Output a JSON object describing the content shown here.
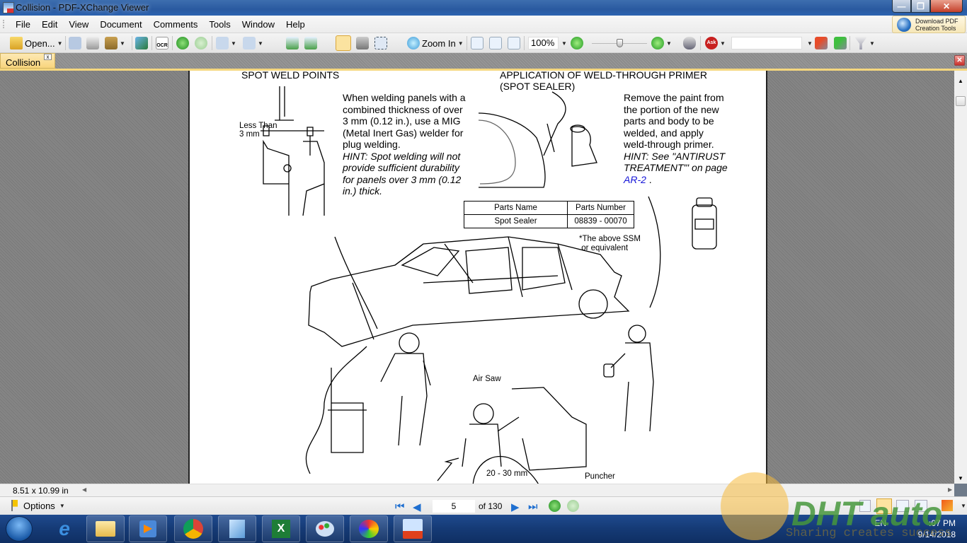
{
  "window": {
    "title": "Collision - PDF-XChange Viewer",
    "minimize_glyph": "—",
    "restore_glyph": "❐",
    "close_glyph": "✕"
  },
  "menu": {
    "items": [
      "File",
      "Edit",
      "View",
      "Document",
      "Comments",
      "Tools",
      "Window",
      "Help"
    ]
  },
  "promo": {
    "line1": "Download PDF",
    "line2": "Creation Tools"
  },
  "toolbar": {
    "open_label": "Open...",
    "zoom_in_label": "Zoom In",
    "zoom_value": "100%",
    "search_value": "",
    "ocr_label": "OCR",
    "ask_label": "Ask",
    "zoom_slider_fraction": 0.5,
    "icons": [
      "open-folder-icon",
      "save-icon",
      "print-icon",
      "email-icon",
      "scan-icon",
      "ocr-icon",
      "back-icon",
      "forward-icon",
      "undo-icon",
      "redo-icon",
      "rotate-left-icon",
      "rotate-right-icon",
      "hand-tool-icon",
      "snapshot-icon",
      "select-text-icon",
      "zoom-in-icon",
      "actual-size-icon",
      "fit-page-icon",
      "fit-width-icon",
      "zoom-out-icon",
      "zoom-plus-icon",
      "find-icon",
      "ask-icon",
      "find-previous-icon",
      "find-next-icon",
      "filter-icon"
    ]
  },
  "tab": {
    "label": "Collision",
    "close_glyph": "x"
  },
  "document": {
    "left_heading": "SPOT WELD POINTS",
    "right_heading_line1": "APPLICATION OF WELD-THROUGH PRIMER",
    "right_heading_line2": "(SPOT SEALER)",
    "caliper_label_1": "Less Than",
    "caliper_label_2": "3 mm",
    "left_para": [
      "When welding panels with a",
      "combined thickness of over",
      "3 mm (0.12 in.), use a MIG",
      "(Metal Inert Gas) welder for",
      "plug welding."
    ],
    "left_hint": [
      "HINT: Spot welding will not",
      "provide sufficient durability",
      "for panels over 3 mm (0.12",
      "in.) thick."
    ],
    "right_para": [
      "Remove the paint from",
      "the portion of the new",
      "parts and body to be",
      "welded, and apply",
      "weld-through  primer."
    ],
    "right_hint": [
      "HINT: See \"ANTIRUST",
      "TREATMENT\"' on page"
    ],
    "right_link": "AR-2",
    "right_link_suffix": " .",
    "parts_table": {
      "headers": [
        "Parts Name",
        "Parts Number"
      ],
      "rows": [
        [
          "Spot Sealer",
          "08839 - 00070"
        ]
      ]
    },
    "ssm_note_1": "*The above SSM",
    "ssm_note_2": " or equivalent",
    "air_saw_label": "Air Saw",
    "range_label": "20 - 30 mm",
    "puncher_label": "Puncher"
  },
  "status": {
    "page_size": "8.51 x 10.99 in",
    "options_label": "Options",
    "current_page": "5",
    "page_total": "of 130"
  },
  "taskbar": {
    "apps": [
      "internet-explorer",
      "file-explorer",
      "media-player",
      "chrome",
      "notepad",
      "excel",
      "paint",
      "download-manager",
      "pdf-xchange-viewer"
    ],
    "time": ":07 PM",
    "date": "9/14/2018",
    "lang": "EN"
  },
  "watermark": {
    "brand": "DHT auto",
    "tagline": "Sharing creates success"
  }
}
